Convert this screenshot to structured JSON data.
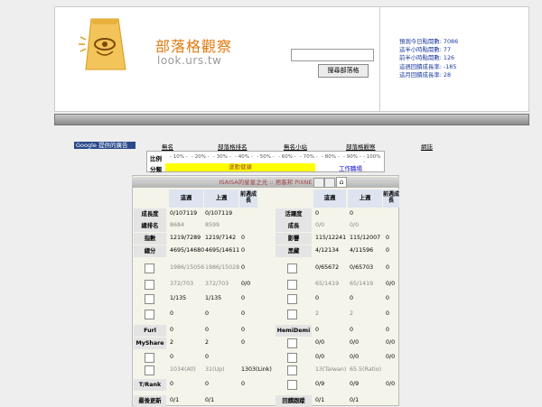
{
  "header": {
    "logo_title": "部落格觀察",
    "logo_url": "look.urs.tw",
    "search_button": "搜尋部落格",
    "stats": [
      "預測今日點閱數: 7086",
      "這半小時點閱數: 77",
      "前半小時點閱數: 126",
      "這週回饋成長率: -185",
      "這月回饋成長率: 28"
    ]
  },
  "nav": {
    "ad_label": "Google 提供的廣告",
    "links": [
      "無名",
      "部落格排名",
      "無名小站",
      "部落格觀察",
      "網誌"
    ]
  },
  "ratio": {
    "label_ratio": "比例",
    "label_category": "分類",
    "options": [
      "- 10% -",
      "- 20% -",
      "- 30% -",
      "- 40% -",
      "- 50% -",
      "- 60% -",
      "- 70% -",
      "- 80% -",
      "- 90% -",
      "- 100% -"
    ],
    "category_selected": "運動健康",
    "category_other": "工作職場"
  },
  "panel": {
    "title": "ISAISA的星星之光 :: 痞客邦 PIXNE",
    "left_headers": [
      "這週",
      "上週",
      "前週成長"
    ],
    "right_headers": [
      "這週",
      "上週",
      "前週成長"
    ],
    "left_rows": [
      {
        "label": "成長度",
        "this": "0/107119",
        "last": "0/107119",
        "growth": ""
      },
      {
        "label": "總排名",
        "this": "8684",
        "last": "8599",
        "growth": ""
      },
      {
        "label": "指數",
        "this": "1219/7289",
        "last": "1219/7142",
        "growth": "0"
      },
      {
        "label": "總分",
        "this": "4695/14680",
        "last": "4695/14611",
        "growth": "0"
      },
      {
        "label": "[!]",
        "this": "1986/15056",
        "last": "1986/15028",
        "growth": "0"
      },
      {
        "label": "(o)",
        "this": "372/703",
        "last": "372/703",
        "growth": "0/0"
      },
      {
        "label": "",
        "this": "1/135",
        "last": "1/135",
        "growth": "0"
      },
      {
        "label": "B",
        "this": "0",
        "last": "0",
        "growth": "0"
      },
      {
        "label": "Furl",
        "this": "0",
        "last": "0",
        "growth": "0"
      },
      {
        "label": "MyShare",
        "this": "2",
        "last": "2",
        "growth": "0"
      },
      {
        "label": "M",
        "this": "0",
        "last": "0",
        "growth": ""
      },
      {
        "label": "",
        "this": "1034(All)",
        "last": "31(Up)",
        "growth": "1303(Link)"
      },
      {
        "label": "T/Rank",
        "this": "0",
        "last": "0",
        "growth": "0"
      },
      {
        "label": "最後更新",
        "this": "0/1",
        "last": "0/1",
        "growth": ""
      }
    ],
    "right_rows": [
      {
        "label": "活躍度",
        "this": "0",
        "last": "0",
        "growth": ""
      },
      {
        "label": "成長",
        "this": "0/0",
        "last": "0/0",
        "growth": ""
      },
      {
        "label": "影響",
        "this": "115/12241",
        "last": "115/12007",
        "growth": "0"
      },
      {
        "label": "黑藏",
        "this": "4/12134",
        "last": "4/11596",
        "growth": "0"
      },
      {
        "label": "×",
        "this": "0/65672",
        "last": "0/65703",
        "growth": "0"
      },
      {
        "label": "- Link",
        "this": "65/1419",
        "last": "65/1419",
        "growth": "0/0"
      },
      {
        "label": "MyWeb",
        "this": "0",
        "last": "0",
        "growth": "0"
      },
      {
        "label": "×",
        "this": "2",
        "last": "2",
        "growth": "0"
      },
      {
        "label": "HemiDemi",
        "this": "0",
        "last": "0",
        "growth": "0"
      },
      {
        "label": "/學",
        "this": "0/0",
        "last": "0/0",
        "growth": "0/0"
      },
      {
        "label": "",
        "this": "0/0",
        "last": "0/0",
        "growth": "0/0"
      },
      {
        "label": "",
        "this": "13(Taiwan)",
        "last": "65.5(Ratio)",
        "growth": ""
      },
      {
        "label": "×",
        "this": "0/9",
        "last": "0/9",
        "growth": "0/0"
      },
      {
        "label": "回饋跟蹤",
        "this": "0/1",
        "last": "0/1",
        "growth": ""
      }
    ]
  },
  "colors": {
    "accent": "#e07a10",
    "stats_blue": "#1a3a9c",
    "ad_bg": "#2a4a8a",
    "category_bg": "#ffff00"
  }
}
